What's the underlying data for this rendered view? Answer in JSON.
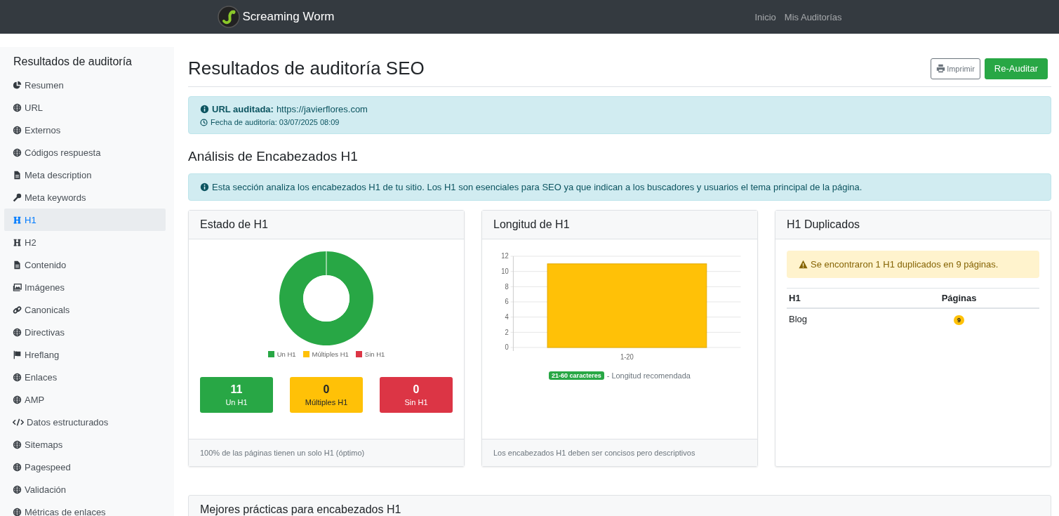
{
  "navbar": {
    "brand": "Screaming Worm",
    "links": [
      "Inicio",
      "Mis Auditorías"
    ]
  },
  "sidebar": {
    "title": "Resultados de auditoría",
    "items": [
      {
        "label": "Resumen",
        "kind": "pie",
        "selected": false
      },
      {
        "label": "URL",
        "kind": "globe",
        "selected": false
      },
      {
        "label": "Externos",
        "kind": "globe",
        "selected": false
      },
      {
        "label": "Códigos respuesta",
        "kind": "globe",
        "selected": false
      },
      {
        "label": "Meta description",
        "kind": "file",
        "selected": false
      },
      {
        "label": "Meta keywords",
        "kind": "key",
        "selected": false
      },
      {
        "label": "H1",
        "kind": "heading",
        "selected": true
      },
      {
        "label": "H2",
        "kind": "heading",
        "selected": false
      },
      {
        "label": "Contenido",
        "kind": "file",
        "selected": false
      },
      {
        "label": "Imágenes",
        "kind": "image",
        "selected": false
      },
      {
        "label": "Canonicals",
        "kind": "link",
        "selected": false
      },
      {
        "label": "Directivas",
        "kind": "globe",
        "selected": false
      },
      {
        "label": "Hreflang",
        "kind": "flag",
        "selected": false
      },
      {
        "label": "Enlaces",
        "kind": "globe",
        "selected": false
      },
      {
        "label": "AMP",
        "kind": "globe",
        "selected": false
      },
      {
        "label": "Datos estructurados",
        "kind": "code",
        "selected": false
      },
      {
        "label": "Sitemaps",
        "kind": "globe",
        "selected": false
      },
      {
        "label": "Pagespeed",
        "kind": "globe",
        "selected": false
      },
      {
        "label": "Validación",
        "kind": "globe",
        "selected": false
      },
      {
        "label": "Métricas de enlaces",
        "kind": "globe",
        "selected": false
      }
    ]
  },
  "page": {
    "title": "Resultados de auditoría SEO",
    "buttons": [
      {
        "label": "Imprimir",
        "kind": "print"
      },
      {
        "label": "Re-Auditar",
        "kind": "primary"
      }
    ]
  },
  "audit_info": {
    "url_label": "URL auditada:",
    "url": "https://javierflores.com",
    "date": "Fecha de auditoría: 03/07/2025 08:09"
  },
  "section": {
    "title": "Análisis de Encabezados H1",
    "info": "Esta sección analiza los encabezados H1 de tu sitio. Los H1 son esenciales para SEO ya que indican a los buscadores y usuarios el tema principal de la página."
  },
  "status_card": {
    "title": "Estado de H1",
    "chart_data": {
      "type": "donut",
      "categories": [
        "Un H1",
        "Múltiples H1",
        "Sin H1"
      ],
      "values": [
        100,
        0,
        0
      ]
    },
    "legend": [
      {
        "color": "#28a745"
      },
      {
        "color": "#ffc107"
      },
      {
        "color": "#dc3545"
      }
    ],
    "stats": [
      {
        "value": "11",
        "label": "Un H1",
        "color": "#28a745"
      },
      {
        "value": "0",
        "label": "Múltiples H1",
        "color": "#ffc107"
      },
      {
        "value": "0",
        "label": "Sin H1",
        "color": "#dc3545"
      }
    ],
    "footer": "100% de las páginas tienen un solo H1 (óptimo)"
  },
  "length_card": {
    "title": "Longitud de H1",
    "chart_data": {
      "type": "bar",
      "categories": [
        "1-20"
      ],
      "values": [
        11
      ],
      "grid": true,
      "ylim": [
        0,
        12
      ],
      "yticks": [
        0,
        2,
        4,
        6,
        8,
        10,
        12
      ]
    },
    "badge": "21-60 caracteres",
    "note": "- Longitud recomendada",
    "footer": "Los encabezados H1 deben ser concisos pero descriptivos"
  },
  "duplicates_card": {
    "title": "H1 Duplicados",
    "warning": "Se encontraron 1 H1 duplicados en 9 páginas.",
    "columns": [
      "H1",
      "Páginas"
    ],
    "rows": [
      {
        "h1": "Blog",
        "pages": "9"
      }
    ]
  },
  "best_practices": {
    "title": "Mejores prácticas para encabezados H1"
  }
}
